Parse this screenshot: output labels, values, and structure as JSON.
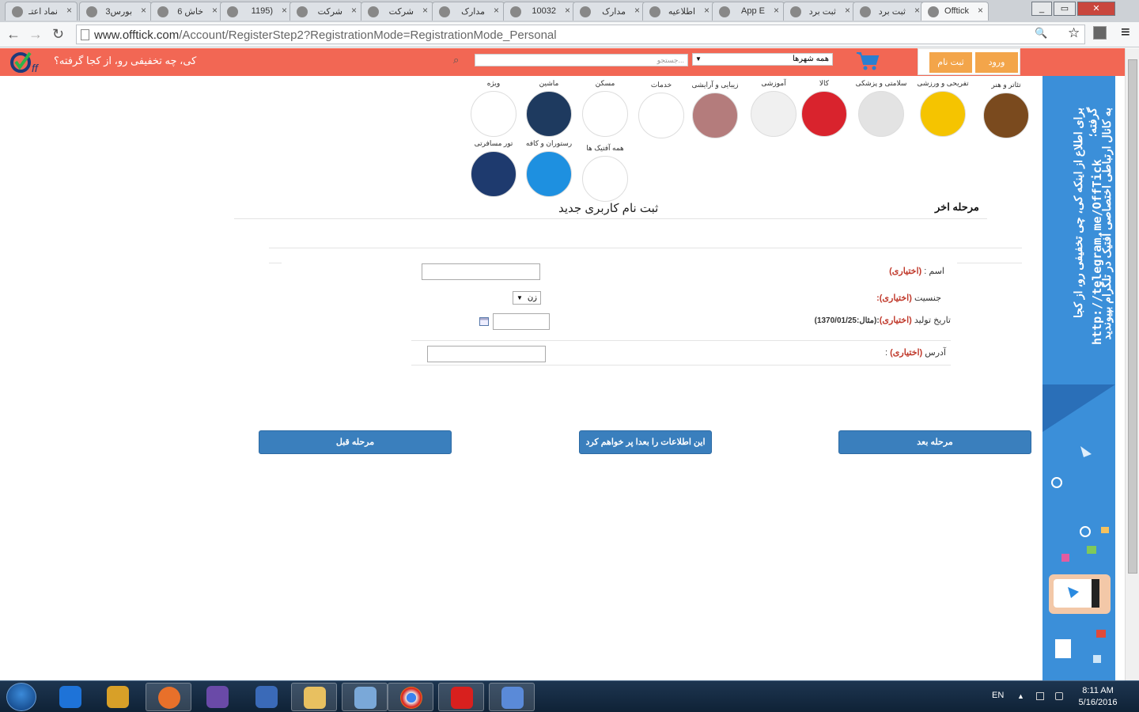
{
  "browser": {
    "tabs": [
      {
        "label": "نماد اعتـ",
        "active": false
      },
      {
        "label": "بورس3",
        "active": false
      },
      {
        "label": "خاش 6",
        "active": false
      },
      {
        "label": "(1195",
        "active": false
      },
      {
        "label": "شرکت",
        "active": false
      },
      {
        "label": "شرکت",
        "active": false
      },
      {
        "label": "مدارک",
        "active": false
      },
      {
        "label": "10032",
        "active": false
      },
      {
        "label": "مدارک",
        "active": false
      },
      {
        "label": "اطلاعیه",
        "active": false
      },
      {
        "label": "App E",
        "active": false
      },
      {
        "label": "ثبت برد",
        "active": false
      },
      {
        "label": "ثبت برد",
        "active": false
      },
      {
        "label": "Offtick",
        "active": true
      }
    ],
    "url_host": "www.offtick.com",
    "url_path": "/Account/RegisterStep2?RegistrationMode=RegistrationMode_Personal",
    "tab_close": "×",
    "back": "←",
    "forward": "→",
    "reload": "↻",
    "minimize": "_",
    "maximize": "▭",
    "close": "✕",
    "zoom_icon": "🔍",
    "star_icon": "☆",
    "menu_icon": "≡"
  },
  "header": {
    "slogan": "کی، چه تخفیفی رو، از کجا گرفته؟",
    "search_placeholder": "جستجو...",
    "search_icon": "⌕",
    "city_select": "همه شهرها",
    "dropdown_arrow": "▼",
    "register_label": "ثبت نام",
    "login_label": "ورود",
    "colors": {
      "header": "#f26754",
      "auth": "#f3a54a",
      "primary": "#3a7fbd"
    }
  },
  "categories": [
    {
      "label": "تئاتر و هنر",
      "icon": "theater-icon",
      "color": "#7a4a1e"
    },
    {
      "label": "تفریحی و ورزشی",
      "icon": "smiley-icon",
      "color": "#f5c400"
    },
    {
      "label": "سلامتی و پزشکی",
      "icon": "heart-icon",
      "color": "#e3e3e3"
    },
    {
      "label": "کالا",
      "icon": "stuff-icon",
      "color": "#d9232d"
    },
    {
      "label": "آموزشی",
      "icon": "books-icon",
      "color": "#f0f0f0"
    },
    {
      "label": "زیبایی و آرایشی",
      "icon": "beauty-icon",
      "color": "#b47c7c"
    },
    {
      "label": "خدمات",
      "icon": "support-icon",
      "color": "#ffffff"
    },
    {
      "label": "مسکن",
      "icon": "house-icon",
      "color": "#ffffff"
    },
    {
      "label": "ماشین",
      "icon": "car-icon",
      "color": "#1e3a5f"
    },
    {
      "label": "ویژه",
      "icon": "dollar-hammer-icon",
      "color": "#ffffff"
    },
    {
      "label": "همه آفتیک ها",
      "icon": "offtick-logo-icon",
      "color": "#ffffff"
    },
    {
      "label": "رستوران و کافه",
      "icon": "fork-knife-icon",
      "color": "#1e90e0"
    },
    {
      "label": "تور مسافرتی",
      "icon": "airplane-icon",
      "color": "#1e3a6e"
    }
  ],
  "form": {
    "step_title": "مرحله اخر",
    "title": "ثبت نام کاربری جدید",
    "optional": "(اختیاری)",
    "name_label": "اسم :",
    "gender_label": "جنسیت",
    "gender_value": "زن",
    "birth_label": "تاریخ تولید",
    "birth_example": ":(مثال:1370/01/25)",
    "address_label": "آدرس",
    "colon": ":"
  },
  "buttons": {
    "next": "مرحله بعد",
    "later": "این اطلاعات را بعدا پر خواهم کرد",
    "prev": "مرحله قبل"
  },
  "banner": {
    "line1": "برای اطلاع از اینکه کی، چی تخفیفی رو، از کجا گرفته؛",
    "line2": "به کانال ارتباطی اختصاصی آفتیک در تلگرام بپیوندید",
    "url": "http://telegram.me/OffTick"
  },
  "taskbar": {
    "lang": "EN",
    "time": "8:11 AM",
    "date": "5/16/2016",
    "apps": [
      "start-orb",
      "internet-explorer",
      "media-player",
      "firefox",
      "visual-studio",
      "app-swirl",
      "file-explorer",
      "notepad",
      "chrome",
      "acrobat",
      "paint"
    ]
  }
}
